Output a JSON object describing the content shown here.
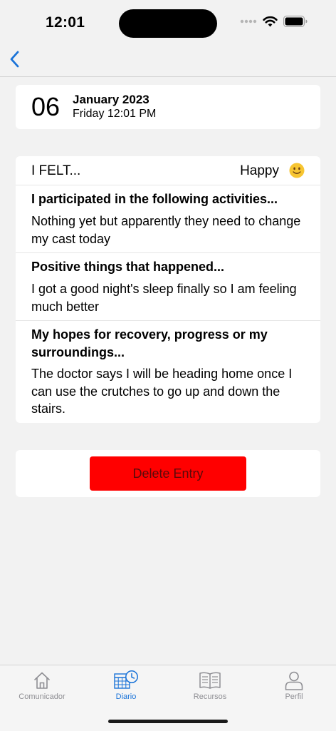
{
  "status_bar": {
    "time": "12:01"
  },
  "nav": {
    "back_icon": "chevron-left-icon"
  },
  "date_card": {
    "day": "06",
    "month_year": "January 2023",
    "weekday_time": "Friday 12:01 PM"
  },
  "entry": {
    "felt_label": "I FELT...",
    "mood": "Happy",
    "mood_icon": "slightly-smiling-face-emoji",
    "sections": [
      {
        "title": "I participated in the following activities...",
        "text": "Nothing yet but apparently they need to change my cast today"
      },
      {
        "title": "Positive things that happened...",
        "text": "I got a good night's sleep finally so I am feeling much better"
      },
      {
        "title": "My hopes for recovery, progress or my surroundings...",
        "text": "The doctor says I will be heading home once I can use the crutches to go up and down the stairs."
      }
    ]
  },
  "delete_button": {
    "label": "Delete Entry",
    "color": "#ff0000"
  },
  "tab_bar": {
    "active_color": "#1a73d8",
    "inactive_color": "#8e8e93",
    "tabs": [
      {
        "label": "Comunicador",
        "icon": "home-icon",
        "active": false
      },
      {
        "label": "Diario",
        "icon": "calendar-clock-icon",
        "active": true
      },
      {
        "label": "Recursos",
        "icon": "book-icon",
        "active": false
      },
      {
        "label": "Perfil",
        "icon": "person-icon",
        "active": false
      }
    ]
  }
}
